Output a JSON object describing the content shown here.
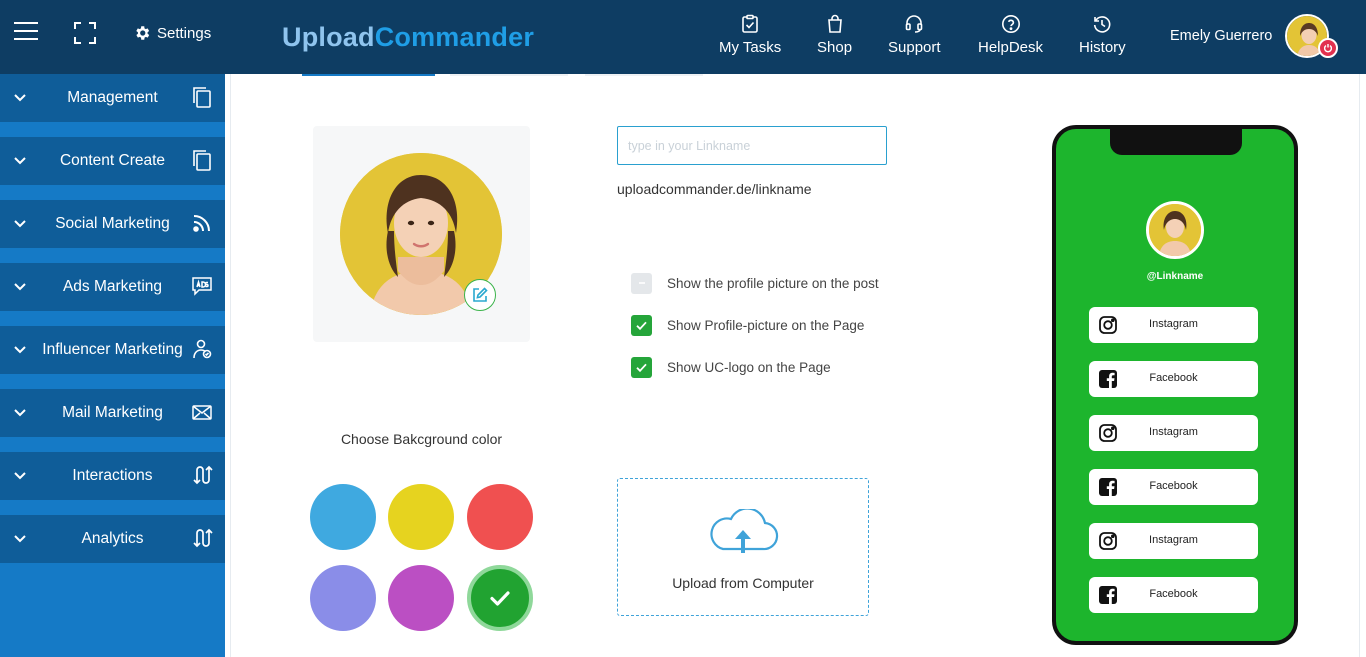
{
  "header": {
    "settings_label": "Settings",
    "logo_part1": "Upload",
    "logo_part2": "Commander",
    "logo_color1": "#8fc4ee",
    "logo_color2": "#1f9ee6",
    "nav": [
      {
        "label": "My Tasks",
        "icon": "clipboard-check-icon"
      },
      {
        "label": "Shop",
        "icon": "shopping-bag-icon"
      },
      {
        "label": "Support",
        "icon": "headset-icon"
      },
      {
        "label": "HelpDesk",
        "icon": "help-circle-icon"
      },
      {
        "label": "History",
        "icon": "history-clock-icon"
      }
    ],
    "user_name": "Emely Guerrero",
    "colors": {
      "bar": "#0e3d63"
    }
  },
  "sidebar": {
    "items": [
      {
        "label": "Management",
        "icon": "copy-icon"
      },
      {
        "label": "Content Create",
        "icon": "copy-icon"
      },
      {
        "label": "Social Marketing",
        "icon": "rss-icon"
      },
      {
        "label": "Ads Marketing",
        "icon": "ads-icon"
      },
      {
        "label": "Influencer Marketing",
        "icon": "influencer-icon"
      },
      {
        "label": "Mail Marketing",
        "icon": "envelope-icon"
      },
      {
        "label": "Interactions",
        "icon": "arrows-swap-icon"
      },
      {
        "label": "Analytics",
        "icon": "arrows-swap-icon"
      }
    ],
    "colors": {
      "item": "#0f5d99",
      "background": "#157ac6"
    }
  },
  "editor": {
    "linkname_placeholder": "type in your Linkname",
    "linkname_value": "",
    "link_url": "uploadcommander.de/linkname",
    "options": [
      {
        "label": "Show the profile picture on the post",
        "checked": false
      },
      {
        "label": "Show Profile-picture on the Page",
        "checked": true
      },
      {
        "label": "Show UC-logo on the Page",
        "checked": true
      }
    ],
    "choose_bg_label": "Choose Bakcground color",
    "swatches": [
      {
        "color": "#3fa9e0",
        "selected": false
      },
      {
        "color": "#e6d31f",
        "selected": false
      },
      {
        "color": "#f05050",
        "selected": false
      },
      {
        "color": "#8a8de8",
        "selected": false
      },
      {
        "color": "#bb4fc3",
        "selected": false
      },
      {
        "color": "#21a331",
        "selected": true
      }
    ],
    "upload_label": "Upload from Computer"
  },
  "preview": {
    "handle": "@Linkname",
    "background": "#1db52d",
    "links": [
      {
        "label": "Instagram",
        "icon": "instagram-icon"
      },
      {
        "label": "Facebook",
        "icon": "facebook-icon"
      },
      {
        "label": "Instagram",
        "icon": "instagram-icon"
      },
      {
        "label": "Facebook",
        "icon": "facebook-icon"
      },
      {
        "label": "Instagram",
        "icon": "instagram-icon"
      },
      {
        "label": "Facebook",
        "icon": "facebook-icon"
      }
    ]
  }
}
